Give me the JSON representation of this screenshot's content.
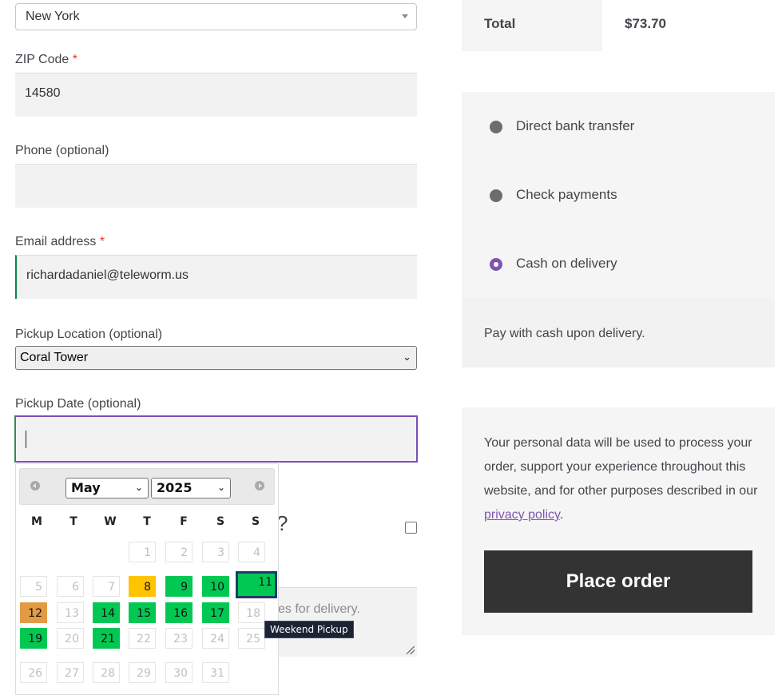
{
  "billing": {
    "state_value": "New York",
    "zip_label": "ZIP Code",
    "zip_required": "*",
    "zip_value": "14580",
    "phone_label": "Phone (optional)",
    "phone_value": "",
    "email_label": "Email address",
    "email_required": "*",
    "email_value": "richardadaniel@teleworm.us",
    "pickup_location_label": "Pickup Location (optional)",
    "pickup_location_value": "Coral Tower",
    "pickup_date_label": "Pickup Date (optional)",
    "pickup_date_value": "",
    "partial_question": "?",
    "notes_partial_text": "es for delivery."
  },
  "datepicker": {
    "month": "May",
    "year": "2025",
    "weekdays": [
      "M",
      "T",
      "W",
      "T",
      "F",
      "S",
      "S"
    ],
    "days": [
      [
        "",
        "",
        "",
        "1",
        "2",
        "3",
        "4"
      ],
      [
        "5",
        "6",
        "7",
        "8",
        "9",
        "10",
        "11"
      ],
      [
        "12",
        "13",
        "14",
        "15",
        "16",
        "17",
        "18"
      ],
      [
        "19",
        "20",
        "21",
        "22",
        "23",
        "24",
        "25"
      ],
      [
        "26",
        "27",
        "28",
        "29",
        "30",
        "31",
        ""
      ]
    ],
    "colors": {
      "available": "#00c853",
      "today": "#ffc400",
      "holiday": "#e29a45",
      "selected_border": "#1f3a6b"
    },
    "tooltip": "Weekend Pickup"
  },
  "order": {
    "total_label": "Total",
    "total_value": "$73.70"
  },
  "payment": {
    "methods": [
      {
        "label": "Direct bank transfer",
        "checked": false
      },
      {
        "label": "Check payments",
        "checked": false
      },
      {
        "label": "Cash on delivery",
        "checked": true
      }
    ],
    "description": "Pay with cash upon delivery."
  },
  "privacy": {
    "text": "Your personal data will be used to process your order, support your experience throughout this website, and for other purposes described in our",
    "link": "privacy policy",
    "end": "."
  },
  "actions": {
    "place_order": "Place order"
  },
  "theme": {
    "accent": "#7f54b3",
    "button_bg": "#333333"
  }
}
